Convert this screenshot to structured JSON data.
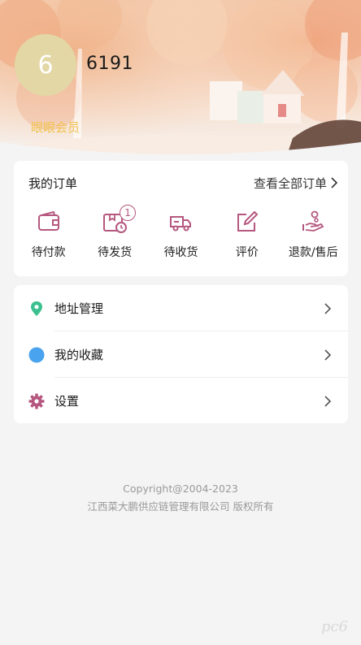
{
  "profile": {
    "avatar_text": "6",
    "username": "6191",
    "member_level": "眼眼会员"
  },
  "orders": {
    "title": "我的订单",
    "view_all": "查看全部订单",
    "items": [
      {
        "label": "待付款",
        "icon": "wallet-icon"
      },
      {
        "label": "待发货",
        "icon": "package-clock-icon",
        "badge": "1"
      },
      {
        "label": "待收货",
        "icon": "truck-icon"
      },
      {
        "label": "评价",
        "icon": "edit-icon"
      },
      {
        "label": "退款/售后",
        "icon": "refund-hand-icon"
      }
    ]
  },
  "menu": {
    "items": [
      {
        "label": "地址管理",
        "icon": "location-pin-icon",
        "color": "#3cc08f"
      },
      {
        "label": "我的收藏",
        "icon": "favorite-dot-icon",
        "color": "#4aa3ef"
      },
      {
        "label": "设置",
        "icon": "gear-icon",
        "color": "#b5577e"
      }
    ]
  },
  "footer": {
    "copyright": "Copyright@2004-2023",
    "company": "江西菜大鹏供应链管理有限公司 版权所有"
  },
  "watermark": "pc6",
  "colors": {
    "accent": "#b5577e",
    "member_gold": "#f2c34e",
    "avatar_bg": "#e3d7a6"
  }
}
